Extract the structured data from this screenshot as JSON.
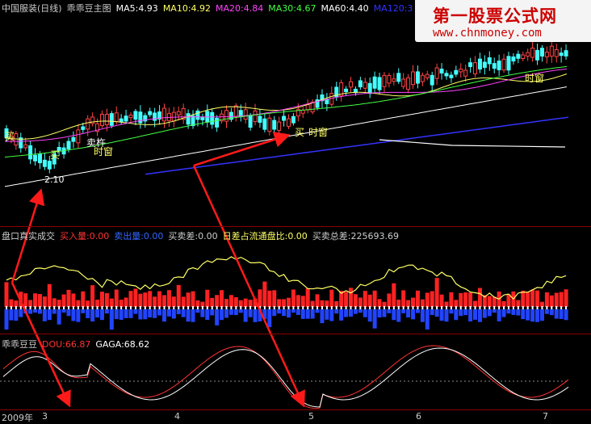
{
  "header_main": [
    {
      "text": "中国服装(日线)",
      "color": "#cccccc"
    },
    {
      "text": "乖乖豆主图",
      "color": "#cccccc"
    },
    {
      "text": "MA5:4.93",
      "color": "#ffffff"
    },
    {
      "text": "MA10:4.92",
      "color": "#ffff66"
    },
    {
      "text": "MA20:4.84",
      "color": "#ff44ff"
    },
    {
      "text": "MA30:4.67",
      "color": "#44ff44"
    },
    {
      "text": "MA60:4.40",
      "color": "#ffffff"
    },
    {
      "text": "MA120:3",
      "color": "#3333ff"
    }
  ],
  "header_volume": [
    {
      "text": "盘口真实成交",
      "color": "#cccccc"
    },
    {
      "text": "买入量:0.00",
      "color": "#ff3333"
    },
    {
      "text": "卖出量:0.00",
      "color": "#3366ff"
    },
    {
      "text": "买卖差:0.00",
      "color": "#cccccc"
    },
    {
      "text": "日差占流通盘比:0.00",
      "color": "#ffff66"
    },
    {
      "text": "买卖总差:225693.69",
      "color": "#cccccc"
    }
  ],
  "header_osc": [
    {
      "text": "乖乖豆豆",
      "color": "#cccccc"
    },
    {
      "text": "DOU:66.87",
      "color": "#ff3333"
    },
    {
      "text": "GAGA:68.62",
      "color": "#ffffff"
    }
  ],
  "watermark": {
    "title": "第一股票公式网",
    "url": "www.chnmoney.com"
  },
  "annotations": {
    "buy1": "买",
    "buy2": "买",
    "buy3": "买",
    "time1": "时窗",
    "time2": "时窗",
    "time3": "时窗",
    "high": "卖杵",
    "low": "2.10"
  },
  "date_axis": [
    "2009年",
    "3",
    "4",
    "5",
    "6",
    "7"
  ]
}
